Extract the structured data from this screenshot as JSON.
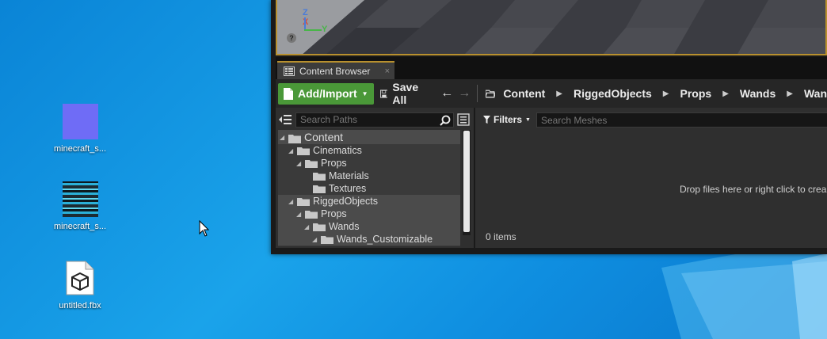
{
  "desktop": {
    "icons": [
      {
        "label": "minecraft_s...",
        "icon": "purple-image-thumbnail"
      },
      {
        "label": "minecraft_s...",
        "icon": "texture-image-thumbnail"
      },
      {
        "label": "untitled.fbx",
        "icon": "fbx-file-icon"
      }
    ]
  },
  "viewport": {
    "axis_z": "Z",
    "axis_x": "X",
    "axis_y": "Y",
    "help_glyph": "?"
  },
  "tab": {
    "label": "Content Browser",
    "close": "×"
  },
  "toolbar": {
    "add_import_label": "Add/Import",
    "save_all_label": "Save All",
    "back_arrow": "←",
    "forward_arrow": "→",
    "breadcrumbs": [
      "Content",
      "RiggedObjects",
      "Props",
      "Wands",
      "Wan"
    ]
  },
  "sources": {
    "search_placeholder": "Search Paths",
    "tree": [
      {
        "label": "Content",
        "level": 0,
        "expanded": true
      },
      {
        "label": "Cinematics",
        "level": 1,
        "expanded": true
      },
      {
        "label": "Props",
        "level": 2,
        "expanded": true
      },
      {
        "label": "Materials",
        "level": 3,
        "expanded": false
      },
      {
        "label": "Textures",
        "level": 3,
        "expanded": false
      },
      {
        "label": "RiggedObjects",
        "level": 1,
        "expanded": true
      },
      {
        "label": "Props",
        "level": 2,
        "expanded": true
      },
      {
        "label": "Wands",
        "level": 3,
        "expanded": true
      },
      {
        "label": "Wands_Customizable",
        "level": 4,
        "expanded": true
      }
    ]
  },
  "assets": {
    "filters_label": "Filters",
    "search_placeholder": "Search Meshes",
    "drop_message": "Drop files here or right click to crea",
    "items_count": "0 items"
  },
  "colors": {
    "accent_gold": "#b8902e",
    "add_button_green": "#4a9838",
    "desktop_blue": "#1aa3ea"
  }
}
